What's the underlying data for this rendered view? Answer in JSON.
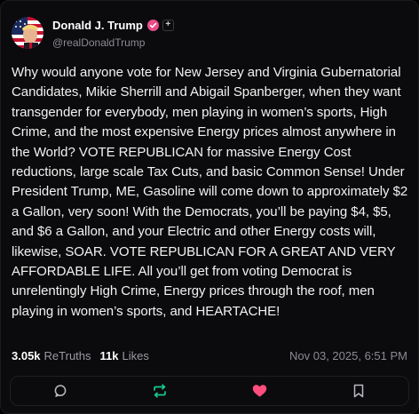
{
  "author": {
    "display_name": "Donald J. Trump",
    "handle": "@realDonaldTrump",
    "verified_icon": "verified-badge-icon",
    "plus_badge": "+"
  },
  "post": {
    "text": "Why would anyone vote for New Jersey and Virginia Gubernatorial Candidates, Mikie Sherrill and Abigail Spanberger, when they want transgender for everybody, men playing in women’s sports, High Crime, and the most expensive Energy prices almost anywhere in the World? VOTE REPUBLICAN for massive Energy Cost reductions, large scale Tax Cuts, and basic Common Sense! Under President Trump, ME, Gasoline will come down to approximately $2 a Gallon, very soon! With the Democrats, you’ll be paying $4, $5, and $6 a Gallon, and your Electric and other Energy costs will, likewise, SOAR. VOTE REPUBLICAN FOR A GREAT AND VERY AFFORDABLE LIFE. All you’ll get from voting Democrat is unrelentingly High Crime, Energy prices through the roof, men playing in women’s sports, and HEARTACHE!"
  },
  "stats": {
    "retruths_count": "3.05k",
    "retruths_label": "ReTruths",
    "likes_count": "11k",
    "likes_label": "Likes",
    "timestamp": "Nov 03, 2025, 6:51 PM"
  },
  "actions": [
    {
      "name": "reply",
      "icon": "comment-icon"
    },
    {
      "name": "retruth",
      "icon": "repost-icon"
    },
    {
      "name": "like",
      "icon": "heart-icon"
    },
    {
      "name": "bookmark",
      "icon": "bookmark-icon"
    }
  ],
  "colors": {
    "background": "#0b0b0d",
    "verified": "#ea4c89",
    "retruth": "#17c890",
    "like": "#ff4d7d",
    "muted": "#8b8b93"
  }
}
